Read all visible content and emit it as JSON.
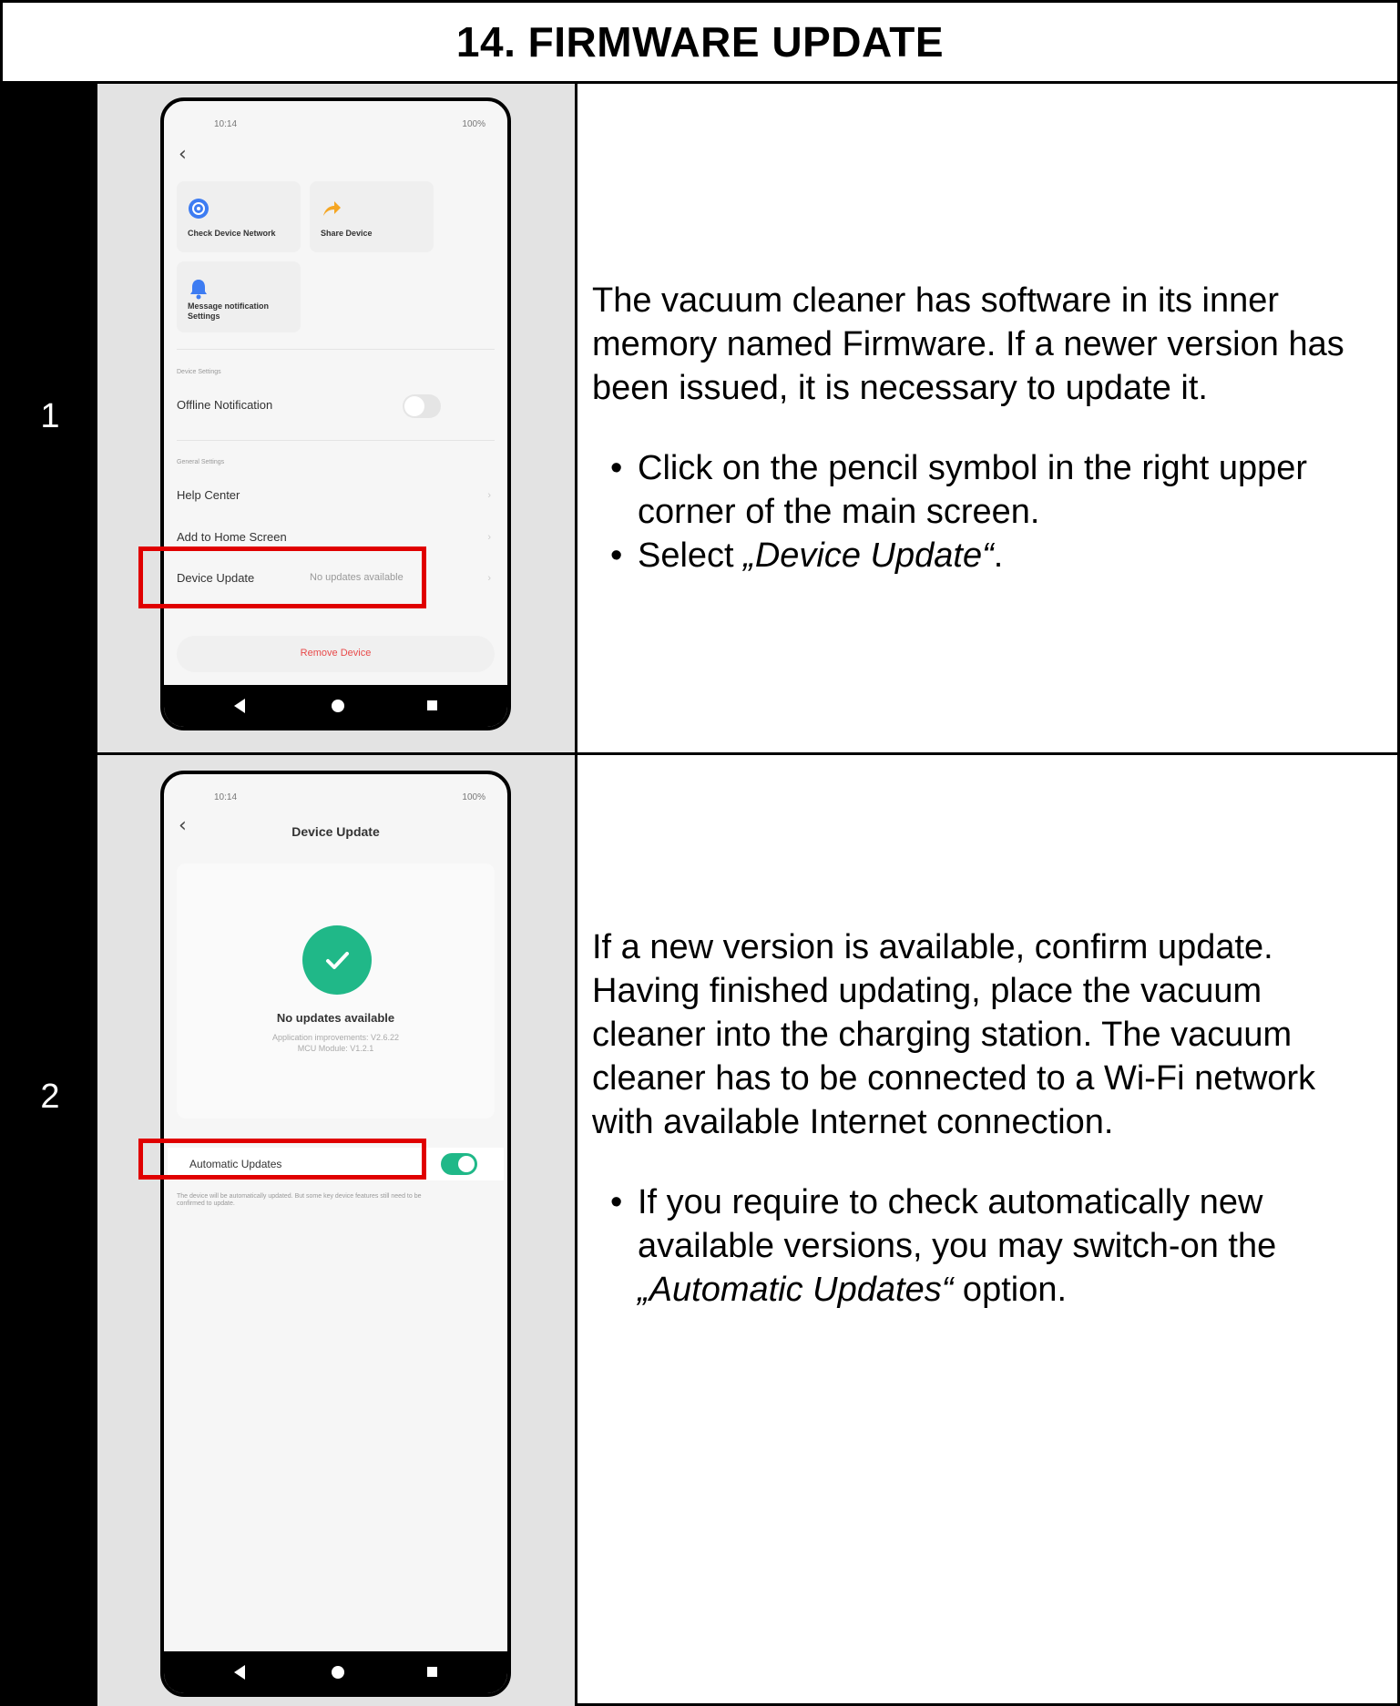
{
  "title": "14. FIRMWARE UPDATE",
  "colors": {
    "highlight": "#e00000",
    "toggle_on": "#20b888",
    "remove": "#e84a4a"
  },
  "steps": [
    {
      "number": "1",
      "text": {
        "paragraph": "The vacuum cleaner has software in its inner memory named Firmware. If a newer version has been issued, it is necessary to update it.",
        "bullet1": "Click on the pencil symbol in the right upper corner of the main screen.",
        "bullet2_prefix": "Select ",
        "bullet2_italic": "„Device Update“",
        "bullet2_suffix": "."
      },
      "phone": {
        "time": "10:14",
        "battery": "100%",
        "tiles": {
          "check_network": "Check Device Network",
          "share": "Share Device",
          "notification": "Message notification Settings"
        },
        "section_device": "Device Settings",
        "offline_notification": "Offline Notification",
        "section_general": "General Settings",
        "help_center": "Help Center",
        "add_home": "Add to Home Screen",
        "device_update": "Device Update",
        "device_update_value": "No updates available",
        "remove": "Remove Device"
      }
    },
    {
      "number": "2",
      "text": {
        "paragraph": "If a new version is available, confirm update. Having finished updating, place the vacuum cleaner into the charging station. The vacuum cleaner has to be connected to a Wi-Fi network with available Internet connection.",
        "bullet1_prefix": "If you require to check automatically new available versions, you may switch-on the ",
        "bullet1_italic": "„Automatic Updates“",
        "bullet1_suffix": " option."
      },
      "phone": {
        "time": "10:14",
        "battery": "100%",
        "header": "Device Update",
        "status": "No updates available",
        "version_app": "Application improvements: V2.6.22",
        "version_mcu": "MCU Module: V1.2.1",
        "auto_updates": "Automatic Updates",
        "auto_note": "The device will be automatically updated. But some key device features still need to be confirmed to update."
      }
    }
  ]
}
